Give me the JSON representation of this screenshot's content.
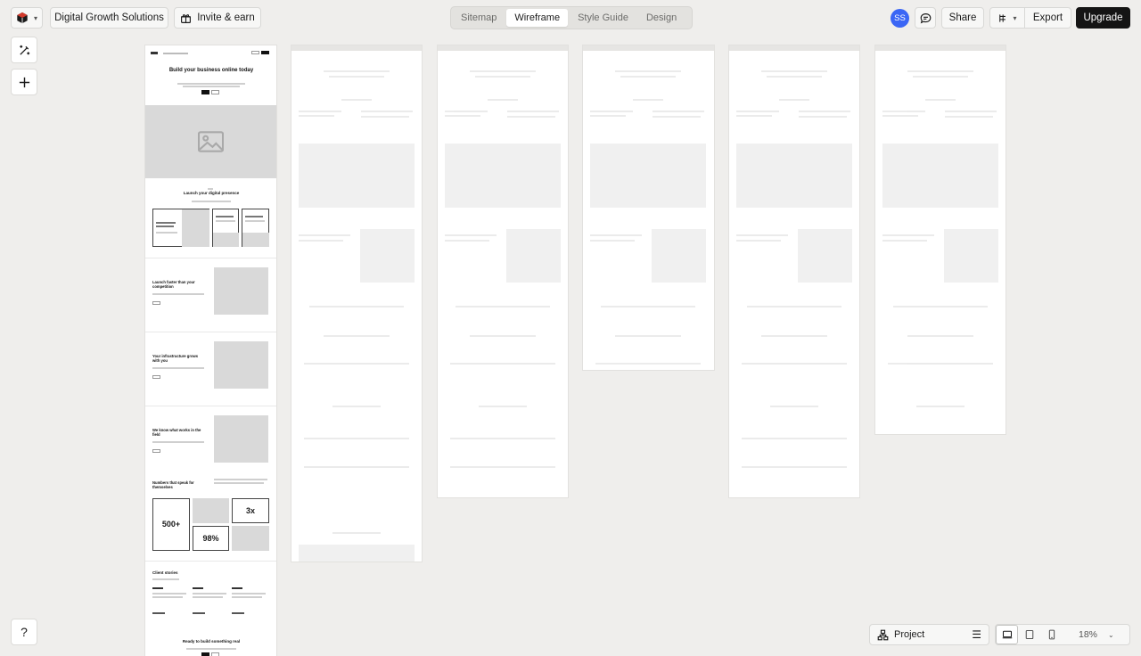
{
  "topbar": {
    "workspace_label": "Digital Growth Solutions",
    "invite_label": "Invite & earn",
    "tabs": [
      {
        "label": "Sitemap",
        "active": false
      },
      {
        "label": "Wireframe",
        "active": true
      },
      {
        "label": "Style Guide",
        "active": false
      },
      {
        "label": "Design",
        "active": false
      }
    ],
    "avatar_initials": "SS",
    "share_label": "Share",
    "export_label": "Export",
    "upgrade_label": "Upgrade"
  },
  "tools": {
    "help_label": "?"
  },
  "wireframe": {
    "hero_title": "Build your business online today",
    "services_title": "Launch your digital presence",
    "feature1_title": "Launch faster than your competition",
    "feature2_title": "Your infrastructure grows with you",
    "feature3_title": "We know what works in the field",
    "numbers_title": "Numbers that speak for themselves",
    "stat1": "500+",
    "stat2": "98%",
    "stat3": "3x",
    "stories_title": "Client stories",
    "cta_title": "Ready to build something real"
  },
  "bottom": {
    "project_label": "Project",
    "zoom_label": "18%"
  },
  "colors": {
    "canvas_bg": "#efeeec",
    "accent_avatar": "#3b66f5",
    "upgrade_bg": "#141414"
  }
}
